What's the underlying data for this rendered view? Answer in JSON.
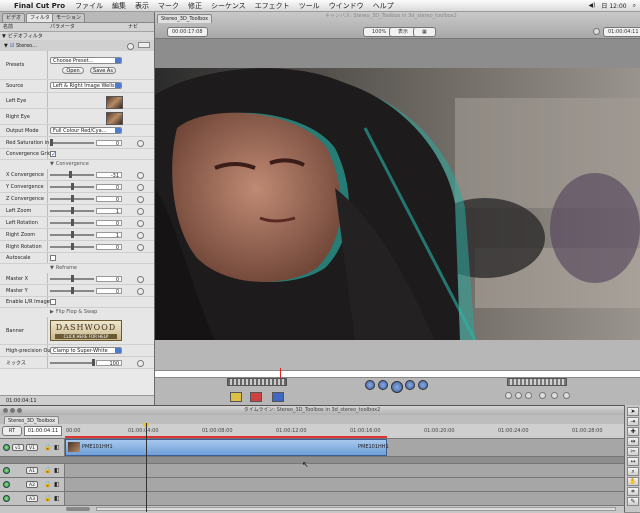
{
  "menubar": {
    "apple": "",
    "app": "Final Cut Pro",
    "items": [
      "ファイル",
      "編集",
      "表示",
      "マーク",
      "修正",
      "シーケンス",
      "エフェクト",
      "ツール",
      "ウインドウ",
      "ヘルプ"
    ],
    "right_text": "日 12:00"
  },
  "filters": {
    "tabs": [
      "ビデオ",
      "フィルタ",
      "モーション"
    ],
    "header": {
      "name": "名前",
      "params": "パラメータ",
      "nav": "ナビ"
    },
    "section_label": "ビデオフィルタ",
    "filter_name": "Stereo...",
    "presets": {
      "label": "Presets",
      "value": "Choose Preset...",
      "open_btn": "Open",
      "save_btn": "Save As"
    },
    "source": {
      "label": "Source",
      "value": "Left & Right Image Wells"
    },
    "left_eye": {
      "label": "Left Eye"
    },
    "right_eye": {
      "label": "Right Eye"
    },
    "output_mode": {
      "label": "Output Mode",
      "value": "Full Colour Red/Cya..."
    },
    "red_saturation": {
      "label": "Red Saturation in",
      "value": "0"
    },
    "convergence_grid": {
      "label": "Convergence Grid"
    },
    "convergence_group": "Convergence",
    "x_conv": {
      "label": "X Convergence",
      "value": "-31"
    },
    "y_conv": {
      "label": "Y Convergence",
      "value": "0"
    },
    "z_conv": {
      "label": "Z Convergence",
      "value": "0"
    },
    "left_zoom": {
      "label": "Left Zoom",
      "value": "1"
    },
    "left_rotation": {
      "label": "Left Rotation",
      "value": "0"
    },
    "right_zoom": {
      "label": "Right Zoom",
      "value": "1"
    },
    "right_rotation": {
      "label": "Right Rotation",
      "value": "0"
    },
    "autoscale": {
      "label": "Autoscale"
    },
    "reframe_group": "Reframe",
    "master_x": {
      "label": "Master X",
      "value": "0"
    },
    "master_y": {
      "label": "Master Y",
      "value": "0"
    },
    "enable_lr": {
      "label": "Enable L/R Image"
    },
    "flipflop_group": "Flip Flop & Swap",
    "banner": {
      "label": "Banner",
      "brand": "DASHWOOD",
      "sub": "CLICK HERE FOR HELP"
    },
    "high_precision": {
      "label": "High-precision Ou",
      "value": "Clamp to Super-White"
    },
    "mix": {
      "label": "ミックス",
      "value": "100"
    },
    "bottom_timecode": "01:00:04:11"
  },
  "viewer": {
    "tab": "Stereo_3D_Toolbox",
    "title_faint": "キャンバス: Stereo_3D_Toolbox in 3d_stereo_toolbox2",
    "left_timecode": "00:00:17:08",
    "right_timecode": "01:00:04:11",
    "zoom_label": "100%",
    "view_label": "表示"
  },
  "timeline": {
    "title": "タイムライン: Stereo_3D_Toolbox in 3d_stereo_toolbox2",
    "tab": "Stereo_3D_Toolbox",
    "rt_label": "RT",
    "timecode": "01:00:04:11",
    "ruler": [
      "00:00",
      "01:00:04:00",
      "01:00:08:00",
      "01:00:12:00",
      "01:00:16:00",
      "01:00:20:00",
      "01:00:24:00",
      "01:00:28:00"
    ],
    "tracks": [
      {
        "src": "v1",
        "dst": "V1",
        "clip": "PME101HH1",
        "clip_end": "PME101HH1"
      },
      {
        "src": "",
        "dst": "A1"
      },
      {
        "src": "",
        "dst": "A2"
      },
      {
        "src": "",
        "dst": "A3"
      }
    ]
  },
  "tools": [
    "arrow-tool",
    "track-select-tool",
    "edit-tool",
    "ripple-tool",
    "razor-tool",
    "slip-tool",
    "pen-tool",
    "zoom-tool",
    "hand-tool",
    "crop-tool",
    "distort-tool"
  ]
}
